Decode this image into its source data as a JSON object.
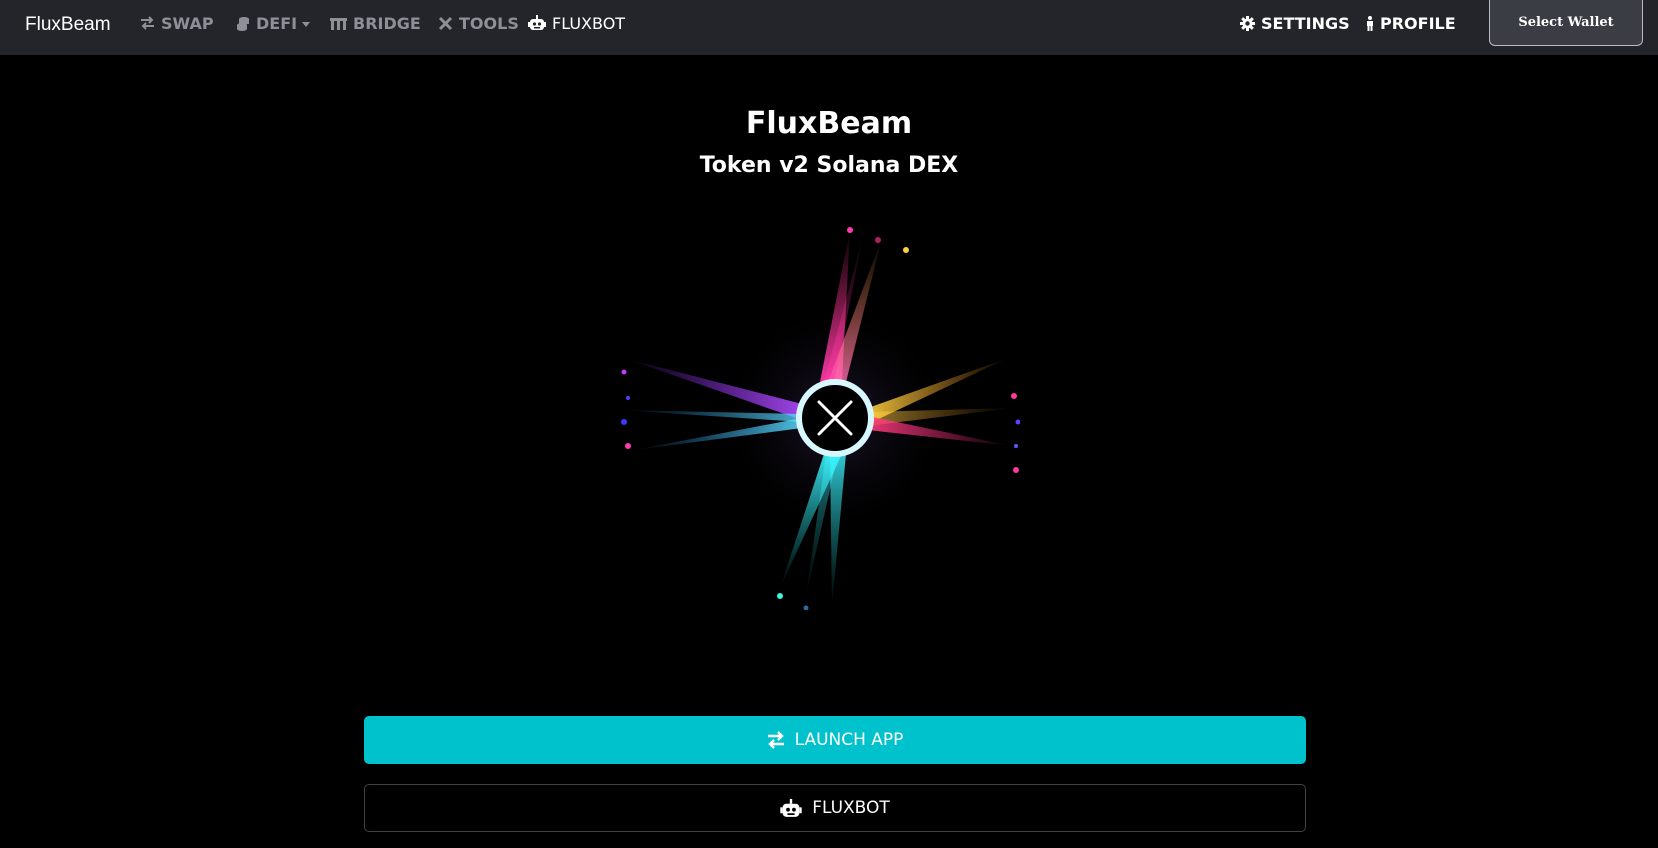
{
  "navbar": {
    "brand": "FluxBeam",
    "items": [
      {
        "label": "SWAP",
        "icon": "swap-arrows-icon"
      },
      {
        "label": "DEFI",
        "icon": "coins-icon",
        "has_dropdown": true
      },
      {
        "label": "BRIDGE",
        "icon": "bridge-icon"
      },
      {
        "label": "TOOLS",
        "icon": "tools-icon"
      },
      {
        "label": "FLUXBOT",
        "icon": "robot-icon",
        "active": true
      }
    ],
    "right_items": [
      {
        "label": "SETTINGS",
        "icon": "gear-icon"
      },
      {
        "label": "PROFILE",
        "icon": "person-icon"
      }
    ],
    "wallet_button": "Select Wallet"
  },
  "hero": {
    "title": "FluxBeam",
    "subtitle": "Token v2 Solana DEX",
    "logo_icon": "close-x-icon"
  },
  "actions": {
    "launch_app": {
      "label": "LAUNCH APP",
      "icon": "swap-arrows-icon"
    },
    "fluxbot": {
      "label": "FLUXBOT",
      "icon": "robot-icon"
    }
  },
  "colors": {
    "navbar_bg": "#23252b",
    "accent": "#00c2cc",
    "nav_inactive": "#8e9097",
    "page_bg": "#000000"
  }
}
